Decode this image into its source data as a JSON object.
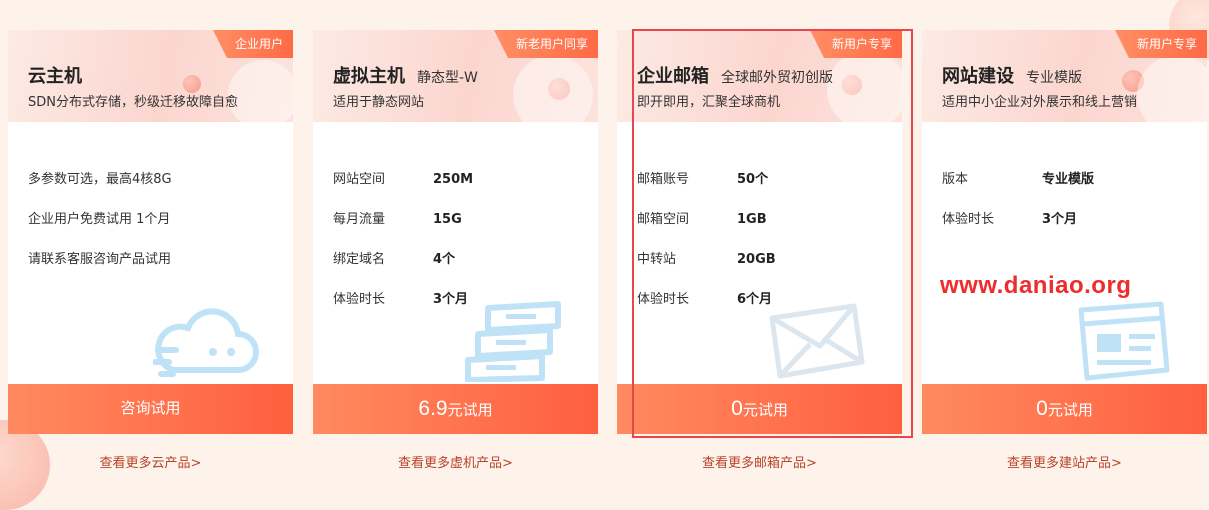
{
  "cards": [
    {
      "tag": "企业用户",
      "title": "云主机",
      "subtitle": "",
      "desc": "SDN分布式存储，秒级迁移故障自愈",
      "features": [
        "多参数可选，最高4核8G",
        "企业用户免费试用 1个月",
        "请联系客服咨询产品试用"
      ],
      "cta_price": "",
      "cta_text": "咨询试用",
      "more_link": "查看更多云产品>",
      "icon": "cloud-icon"
    },
    {
      "tag": "新老用户同享",
      "title": "虚拟主机",
      "subtitle": "静态型-W",
      "desc": "适用于静态网站",
      "specs": [
        {
          "label": "网站空间",
          "value": "250M"
        },
        {
          "label": "每月流量",
          "value": "15G"
        },
        {
          "label": "绑定域名",
          "value": "4个"
        },
        {
          "label": "体验时长",
          "value": "3个月"
        }
      ],
      "cta_price": "6.9",
      "cta_text": "元试用",
      "more_link": "查看更多虚机产品>",
      "icon": "server-icon"
    },
    {
      "tag": "新用户专享",
      "title": "企业邮箱",
      "subtitle": "全球邮外贸初创版",
      "desc": "即开即用，汇聚全球商机",
      "specs": [
        {
          "label": "邮箱账号",
          "value": "50个"
        },
        {
          "label": "邮箱空间",
          "value": "1GB"
        },
        {
          "label": "中转站",
          "value": "20GB"
        },
        {
          "label": "体验时长",
          "value": "6个月"
        }
      ],
      "cta_price": "0",
      "cta_text": "元试用",
      "more_link": "查看更多邮箱产品>",
      "icon": "mail-icon"
    },
    {
      "tag": "新用户专享",
      "title": "网站建设",
      "subtitle": "专业模版",
      "desc": "适用中小企业对外展示和线上营销",
      "specs": [
        {
          "label": "版本",
          "value": "专业模版"
        },
        {
          "label": "体验时长",
          "value": "3个月"
        }
      ],
      "cta_price": "0",
      "cta_text": "元试用",
      "more_link": "查看更多建站产品>",
      "icon": "website-icon"
    }
  ],
  "overlay": {
    "url": "www.daniao.org",
    "color": "#ef2c2c"
  },
  "colors": {
    "accent": "#ff6a45",
    "highlight": "#e8454c",
    "link": "#b8432b"
  }
}
